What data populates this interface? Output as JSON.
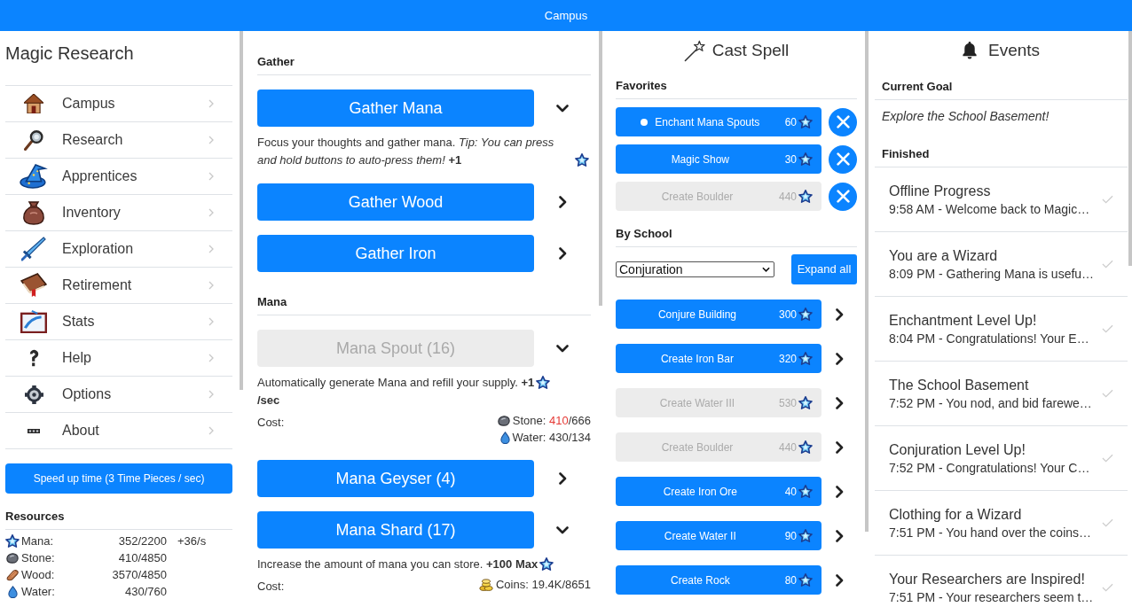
{
  "title_bar": {
    "title": "Campus"
  },
  "sidebar": {
    "title": "Magic Research",
    "items": [
      {
        "label": "Campus"
      },
      {
        "label": "Research"
      },
      {
        "label": "Apprentices"
      },
      {
        "label": "Inventory"
      },
      {
        "label": "Exploration"
      },
      {
        "label": "Retirement"
      },
      {
        "label": "Stats"
      },
      {
        "label": "Help"
      },
      {
        "label": "Options"
      },
      {
        "label": "About"
      }
    ],
    "speed_button": "Speed up time (3 Time Pieces / sec)",
    "resources": {
      "heading": "Resources",
      "rows": [
        {
          "kind": "mana",
          "name": "Mana:",
          "amount": "352/2200",
          "rate": "+36/s"
        },
        {
          "kind": "stone",
          "name": "Stone:",
          "amount": "410/4850"
        },
        {
          "kind": "wood",
          "name": "Wood:",
          "amount": "3570/4850"
        },
        {
          "kind": "water",
          "name": "Water:",
          "amount": "430/760"
        }
      ]
    }
  },
  "main": {
    "sections": [
      {
        "heading": "Gather",
        "items": [
          {
            "label": "Gather Mana",
            "expanded": true,
            "disabled": false,
            "description": "Focus your thoughts and gather mana. *Tip: You can press and hold buttons to auto-press them!* **+1**"
          },
          {
            "label": "Gather Wood",
            "expanded": false,
            "disabled": false
          },
          {
            "label": "Gather Iron",
            "expanded": false,
            "disabled": false
          }
        ]
      },
      {
        "heading": "Mana",
        "items": [
          {
            "label": "Mana Spout (16)",
            "expanded": true,
            "disabled": true,
            "description": "Automatically generate Mana and refill your supply. **+1**",
            "suffix": "/sec",
            "cost_label": "Cost:",
            "costs": [
              {
                "kind": "stone",
                "name": "Stone:",
                "have": "410",
                "need": "/666",
                "short": true
              },
              {
                "kind": "water",
                "name": "Water:",
                "have": "430",
                "need": "/134",
                "short": false
              }
            ]
          },
          {
            "label": "Mana Geyser (4)",
            "expanded": false,
            "disabled": false
          },
          {
            "label": "Mana Shard (17)",
            "expanded": true,
            "disabled": false,
            "description": "Increase the amount of mana you can store. **+100 Max**",
            "cost_label": "Cost:",
            "costs": [
              {
                "kind": "coins",
                "name": "Coins:",
                "have": "19.4K",
                "need": "/8651",
                "short": false
              }
            ]
          }
        ]
      }
    ]
  },
  "cast_spell": {
    "title": "Cast Spell",
    "favorites": {
      "heading": "Favorites",
      "items": [
        {
          "name": "Enchant Mana Spouts",
          "cost": "60",
          "active": true,
          "disabled": false
        },
        {
          "name": "Magic Show",
          "cost": "30",
          "active": false,
          "disabled": false
        },
        {
          "name": "Create Boulder",
          "cost": "440",
          "active": false,
          "disabled": true
        }
      ]
    },
    "by_school": {
      "heading": "By School",
      "school": "Conjuration",
      "expand_button": "Expand all",
      "spells": [
        {
          "name": "Conjure Building",
          "cost": "300",
          "disabled": false,
          "expanded": false
        },
        {
          "name": "Create Iron Bar",
          "cost": "320",
          "disabled": false,
          "expanded": false
        },
        {
          "name": "Create Water III",
          "cost": "530",
          "disabled": true,
          "expanded": false
        },
        {
          "name": "Create Boulder",
          "cost": "440",
          "disabled": true,
          "expanded": false
        },
        {
          "name": "Create Iron Ore",
          "cost": "40",
          "disabled": false,
          "expanded": false
        },
        {
          "name": "Create Water II",
          "cost": "90",
          "disabled": false,
          "expanded": false
        },
        {
          "name": "Create Rock",
          "cost": "80",
          "disabled": false,
          "expanded": false
        }
      ]
    }
  },
  "events": {
    "title": "Events",
    "goal_heading": "Current Goal",
    "goal": "Explore the School Basement!",
    "finished_heading": "Finished",
    "items": [
      {
        "title": "Offline Progress",
        "detail": "9:58 AM - Welcome back to Magic…"
      },
      {
        "title": "You are a Wizard",
        "detail": "8:09 PM - Gathering Mana is usefu…"
      },
      {
        "title": "Enchantment Level Up!",
        "detail": "8:04 PM - Congratulations! Your E…"
      },
      {
        "title": "The School Basement",
        "detail": "7:52 PM - You nod, and bid farewe…"
      },
      {
        "title": "Conjuration Level Up!",
        "detail": "7:52 PM - Congratulations! Your C…"
      },
      {
        "title": "Clothing for a Wizard",
        "detail": "7:51 PM - You hand over the coins…"
      },
      {
        "title": "Your Researchers are Inspired!",
        "detail": "7:51 PM - Your researchers seem t…"
      }
    ]
  }
}
